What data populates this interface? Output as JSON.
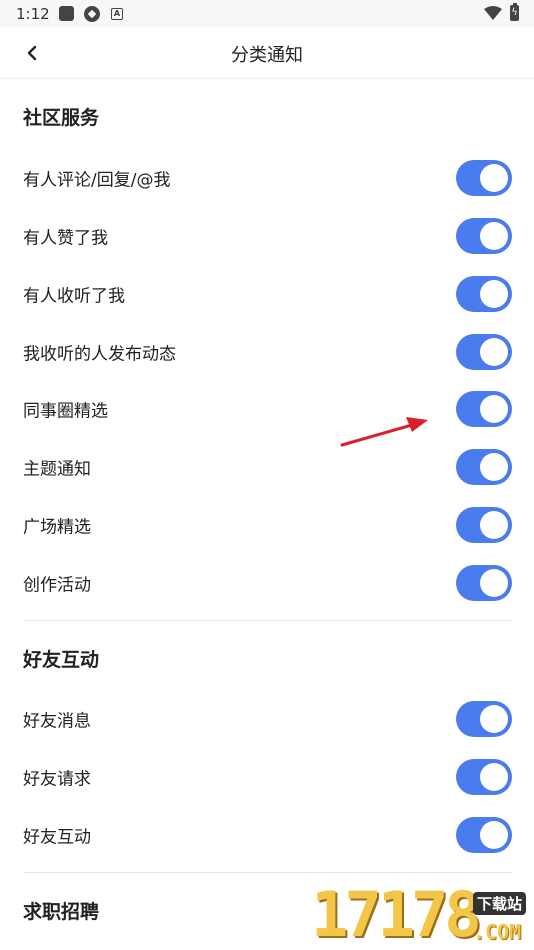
{
  "status_bar": {
    "time": "1:12",
    "battery_glyph": "ϟ"
  },
  "header": {
    "title": "分类通知",
    "back_icon": "chevron-left-icon"
  },
  "sections": [
    {
      "title": "社区服务",
      "items": [
        {
          "label": "有人评论/回复/@我",
          "enabled": true
        },
        {
          "label": "有人赞了我",
          "enabled": true
        },
        {
          "label": "有人收听了我",
          "enabled": true
        },
        {
          "label": "我收听的人发布动态",
          "enabled": true
        },
        {
          "label": "同事圈精选",
          "enabled": true
        },
        {
          "label": "主题通知",
          "enabled": true
        },
        {
          "label": "广场精选",
          "enabled": true
        },
        {
          "label": "创作活动",
          "enabled": true
        }
      ]
    },
    {
      "title": "好友互动",
      "items": [
        {
          "label": "好友消息",
          "enabled": true
        },
        {
          "label": "好友请求",
          "enabled": true
        },
        {
          "label": "好友互动",
          "enabled": true
        }
      ]
    },
    {
      "title": "求职招聘",
      "items": []
    }
  ],
  "watermark": {
    "digits": "17178",
    "badge": "下载站",
    "suffix": ".COM"
  },
  "colors": {
    "toggle_on": "#4a7cf0",
    "annotation_arrow": "#d9202a",
    "watermark": "#f3c64a"
  }
}
